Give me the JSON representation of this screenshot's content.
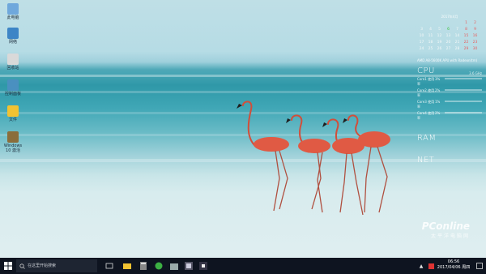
{
  "desktop_icons": [
    {
      "label": "此电脑",
      "icon": "computer-icon",
      "color": "#6fa8dc"
    },
    {
      "label": "网络",
      "icon": "network-icon",
      "color": "#3d85c6"
    },
    {
      "label": "回收站",
      "icon": "recycle-bin-icon",
      "color": "#d9d9d9"
    },
    {
      "label": "控制面板",
      "icon": "control-panel-icon",
      "color": "#4a90c0"
    },
    {
      "label": "文件",
      "icon": "folder-icon",
      "color": "#f1c232"
    },
    {
      "label": "Windows 10 激活",
      "icon": "activator-icon",
      "color": "#8a6d3b"
    }
  ],
  "calendar": {
    "header": "2017年4月",
    "days": [
      "",
      "",
      "",
      "",
      "",
      "1",
      "2",
      "3",
      "4",
      "5",
      "6",
      "7",
      "8",
      "9",
      "10",
      "11",
      "12",
      "13",
      "14",
      "15",
      "16",
      "17",
      "18",
      "19",
      "20",
      "21",
      "22",
      "23",
      "24",
      "25",
      "26",
      "27",
      "28",
      "29",
      "30"
    ],
    "today": "6"
  },
  "system_monitor": {
    "cpu_name": "AMD A8-5600K APU with Radeon(tm)",
    "cpu_label": "CPU",
    "cpu_speed": "3.6 GHz",
    "cores": [
      {
        "name": "Core1 使用率",
        "value": "3%"
      },
      {
        "name": "Core2 使用率",
        "value": "2%"
      },
      {
        "name": "Core3 使用率",
        "value": "1%"
      },
      {
        "name": "Core4 使用率",
        "value": "2%"
      }
    ],
    "ram_label": "RAM",
    "net_label": "NET"
  },
  "taskbar": {
    "search_placeholder": "在这里开始搜索",
    "clock_time": "06:56",
    "clock_date": "2017/04/06 周四"
  },
  "watermark": {
    "brand": "PConline",
    "subtitle": "太平洋电脑网"
  },
  "colors": {
    "taskbar": "#0e1420",
    "accent": "#0078d7"
  }
}
